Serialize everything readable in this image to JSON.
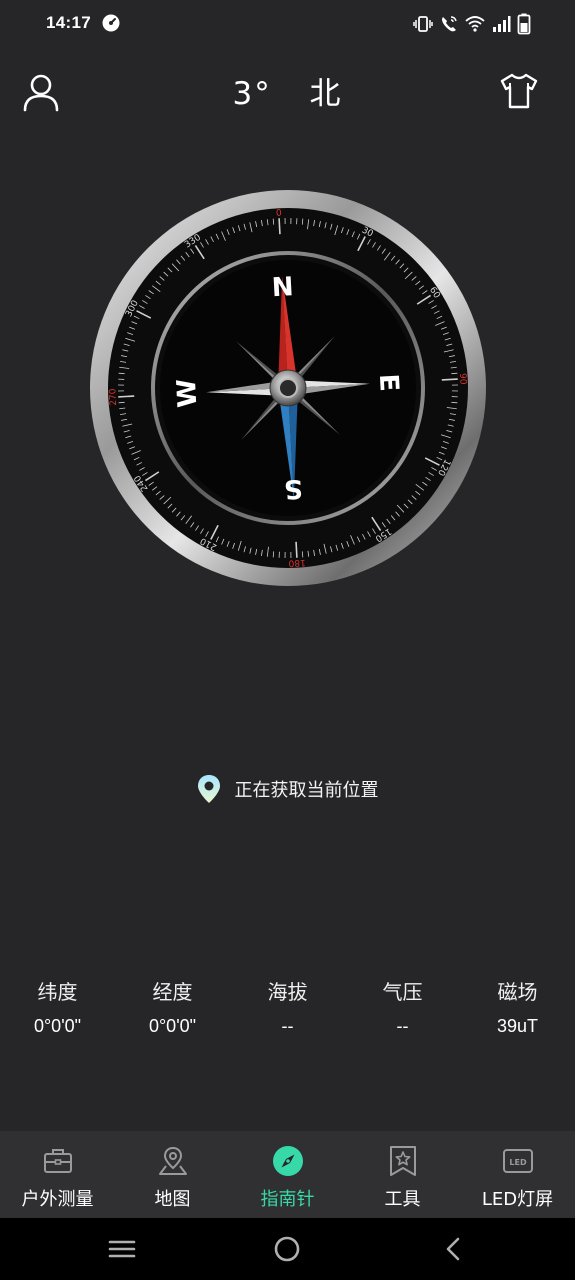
{
  "status_bar": {
    "time": "14:17",
    "icons": [
      "vibrate-icon",
      "wifi-calling-icon",
      "wifi-icon",
      "signal-icon",
      "battery-icon"
    ]
  },
  "header": {
    "heading_degree": "3°",
    "heading_direction": "北",
    "left_icon": "profile-icon",
    "right_icon": "shirt-icon"
  },
  "compass": {
    "heading_value": 3,
    "cardinals": [
      "N",
      "E",
      "S",
      "W"
    ],
    "dial_labels": [
      "0",
      "30",
      "60",
      "90",
      "120",
      "150",
      "180",
      "210",
      "240",
      "270",
      "300",
      "330"
    ],
    "accent_red": "#d8342c",
    "accent_blue": "#2f7fc1"
  },
  "location": {
    "icon": "location-pin-icon",
    "text": "正在获取当前位置"
  },
  "metrics": [
    {
      "label": "纬度",
      "value": "0°0'0\""
    },
    {
      "label": "经度",
      "value": "0°0'0\""
    },
    {
      "label": "海拔",
      "value": "--"
    },
    {
      "label": "气压",
      "value": "--"
    },
    {
      "label": "磁场",
      "value": "39uT"
    }
  ],
  "bottom_nav": {
    "active_color": "#38d9a9",
    "items": [
      {
        "label": "户外测量",
        "icon": "toolbox-icon"
      },
      {
        "label": "地图",
        "icon": "map-pin-icon"
      },
      {
        "label": "指南针",
        "icon": "compass-icon",
        "active": true
      },
      {
        "label": "工具",
        "icon": "bookmark-star-icon"
      },
      {
        "label": "LED灯屏",
        "icon": "led-icon"
      }
    ]
  },
  "system_nav": [
    "menu-icon",
    "home-icon",
    "back-icon"
  ]
}
